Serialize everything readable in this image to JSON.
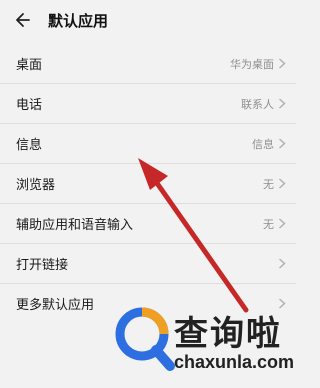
{
  "header": {
    "title": "默认应用"
  },
  "rows": [
    {
      "label": "桌面",
      "value": "华为桌面"
    },
    {
      "label": "电话",
      "value": "联系人"
    },
    {
      "label": "信息",
      "value": "信息"
    },
    {
      "label": "浏览器",
      "value": "无"
    },
    {
      "label": "辅助应用和语音输入",
      "value": "无"
    },
    {
      "label": "打开链接",
      "value": ""
    },
    {
      "label": "更多默认应用",
      "value": ""
    }
  ],
  "watermark": {
    "text": "查询啦",
    "url": "chaxunla.com"
  },
  "colors": {
    "annotation_arrow": "#c62828",
    "logo_blue": "#2d6fe0",
    "logo_orange": "#f0a020"
  }
}
